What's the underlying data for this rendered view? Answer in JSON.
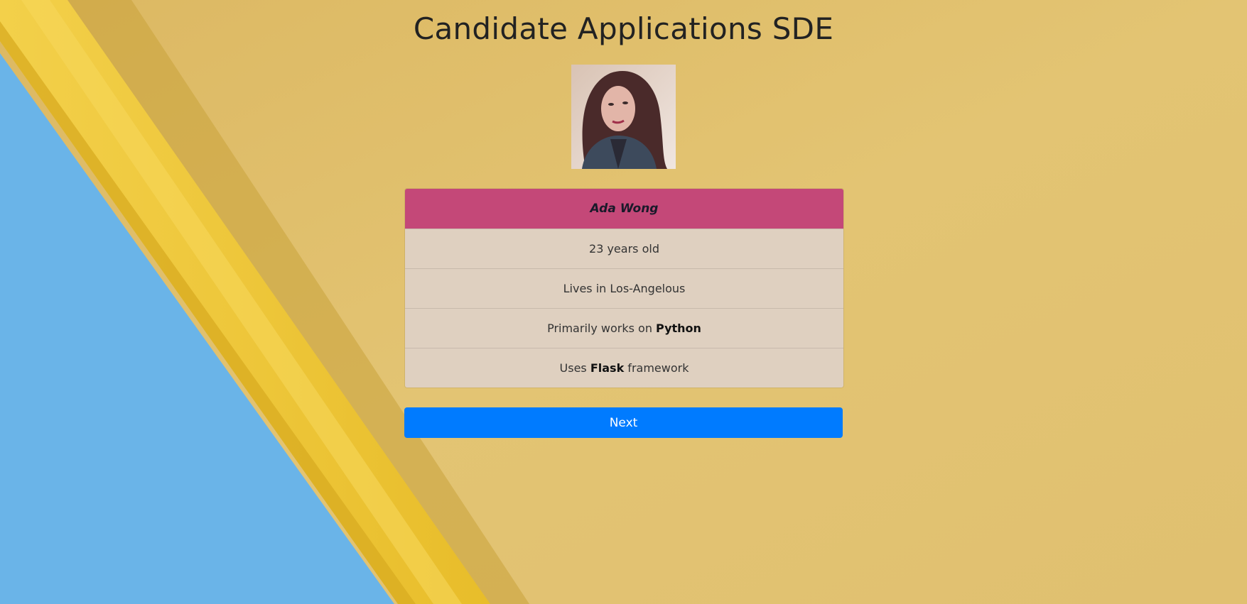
{
  "page": {
    "title": "Candidate Applications SDE"
  },
  "candidate": {
    "photo_alt": "candidate portrait",
    "name": "Ada Wong",
    "age_text": "23 years old",
    "location_text": "Lives in Los-Angelous",
    "language_prefix": "Primarily works on ",
    "language": "Python",
    "framework_prefix": "Uses ",
    "framework": "Flask",
    "framework_suffix": " framework"
  },
  "actions": {
    "next_label": "Next"
  },
  "colors": {
    "header_accent": "#c44878",
    "button_primary": "#007bff",
    "background_paper": "#e2c06c",
    "background_blue": "#6ab4e8",
    "pencil_yellow": "#f0c530"
  }
}
